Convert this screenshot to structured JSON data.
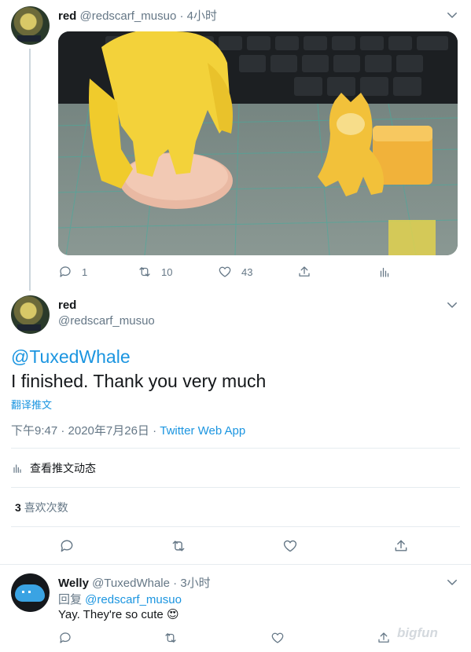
{
  "tweet1": {
    "display_name": "red",
    "handle": "@redscarf_musuo",
    "time": "4小时",
    "replies": "1",
    "retweets": "10",
    "likes": "43"
  },
  "tweet2": {
    "display_name": "red",
    "handle": "@redscarf_musuo",
    "mention": "@TuxedWhale",
    "text": "I finished. Thank you very much",
    "translate": "翻译推文",
    "timestamp": "下午9:47 · 2020年7月26日 · ",
    "source": "Twitter Web App",
    "activity": "查看推文动态",
    "likes_count": "3",
    "likes_label": "喜欢次数"
  },
  "tweet3": {
    "display_name": "Welly",
    "handle": "@TuxedWhale",
    "time": "3小时",
    "reply_prefix": "回复 ",
    "reply_to": "@redscarf_musuo",
    "text": "Yay. They're so cute ",
    "emoji": "😍"
  },
  "watermark": "bigfun",
  "colors": {
    "link": "#1b95e0",
    "muted": "#657786",
    "divider": "#e6ecf0"
  }
}
